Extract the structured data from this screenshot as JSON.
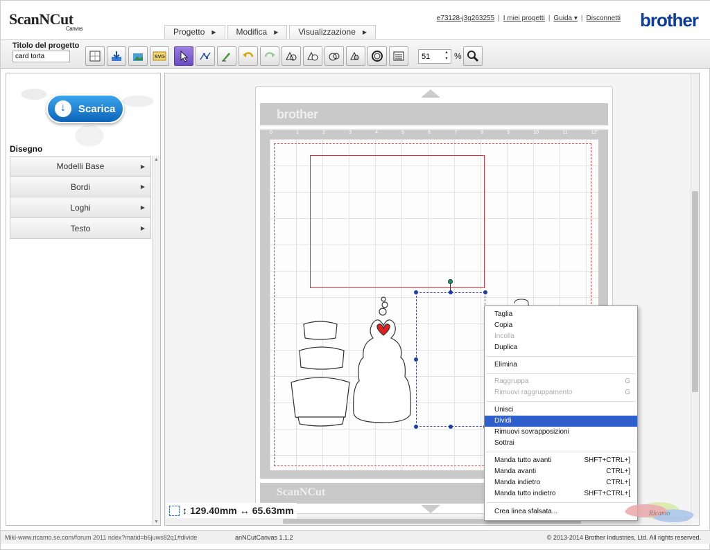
{
  "app": {
    "logo_text": "ScanNCut",
    "logo_sub": "Canvas",
    "brand": "brother"
  },
  "menus": [
    {
      "label": "Progetto"
    },
    {
      "label": "Modifica"
    },
    {
      "label": "Visualizzazione"
    }
  ],
  "top_links": {
    "user": "e73128-j3g263255",
    "projects": "I miei progetti",
    "guide": "Guida",
    "logout": "Disconnetti"
  },
  "toolbar": {
    "project_title_label": "Titolo del progetto",
    "project_title_value": "card torta",
    "zoom_value": "51",
    "zoom_unit": "%",
    "tools": [
      "new-icon",
      "download-icon",
      "image-import-icon",
      "svg-import-icon",
      "select-icon",
      "node-edit-icon",
      "pen-icon",
      "undo-icon",
      "redo-icon",
      "shape-icon",
      "shape-alt-icon",
      "shape-weld-icon",
      "shape-subtract-icon",
      "circle-icon",
      "list-icon"
    ]
  },
  "left_panel": {
    "download_label": "Scarica",
    "section_title": "Disegno",
    "categories": [
      {
        "label": "Modelli Base"
      },
      {
        "label": "Bordi"
      },
      {
        "label": "Loghi"
      },
      {
        "label": "Testo"
      }
    ]
  },
  "canvas": {
    "mat_brand_top": "brother",
    "mat_brand_bottom": "ScanNCut",
    "ruler_numbers": [
      "0",
      "1",
      "2",
      "3",
      "4",
      "5",
      "6",
      "7",
      "8",
      "9",
      "10",
      "11",
      "12\""
    ],
    "height_value": "129.40mm",
    "width_value": "65.63mm"
  },
  "context_menu": {
    "items": [
      {
        "label": "Taglia",
        "shortcut": "",
        "disabled": false
      },
      {
        "label": "Copia",
        "shortcut": "",
        "disabled": false
      },
      {
        "label": "Incolla",
        "shortcut": "",
        "disabled": true
      },
      {
        "label": "Duplica",
        "shortcut": "",
        "disabled": false
      },
      {
        "label": "Elimina",
        "shortcut": "",
        "disabled": false
      },
      {
        "label": "Raggruppa",
        "shortcut": "G",
        "disabled": true
      },
      {
        "label": "Rimuovi raggruppamento",
        "shortcut": "G",
        "disabled": true
      },
      {
        "label": "Unisci",
        "shortcut": "",
        "disabled": false
      },
      {
        "label": "Dividi",
        "shortcut": "",
        "disabled": false,
        "selected": true
      },
      {
        "label": "Rimuovi sovrapposizioni",
        "shortcut": "",
        "disabled": false
      },
      {
        "label": "Sottrai",
        "shortcut": "",
        "disabled": false
      },
      {
        "label": "Manda tutto avanti",
        "shortcut": "SHFT+CTRL+]",
        "disabled": false
      },
      {
        "label": "Manda avanti",
        "shortcut": "CTRL+]",
        "disabled": false
      },
      {
        "label": "Manda indietro",
        "shortcut": "CTRL+[",
        "disabled": false
      },
      {
        "label": "Manda tutto indietro",
        "shortcut": "SHFT+CTRL+[",
        "disabled": false
      },
      {
        "label": "Crea linea sfalsata...",
        "shortcut": "",
        "disabled": false
      }
    ]
  },
  "statusbar": {
    "url": "Miki-www.ricamo.se.com/forum 2011 ndex?matid=b6juws82q1#divide",
    "version": "anNCutCanvas 1.1.2",
    "copyright": "© 2013-2014 Brother Industries, Ltd. All rights reserved."
  },
  "watermark_text": "Ricamo"
}
